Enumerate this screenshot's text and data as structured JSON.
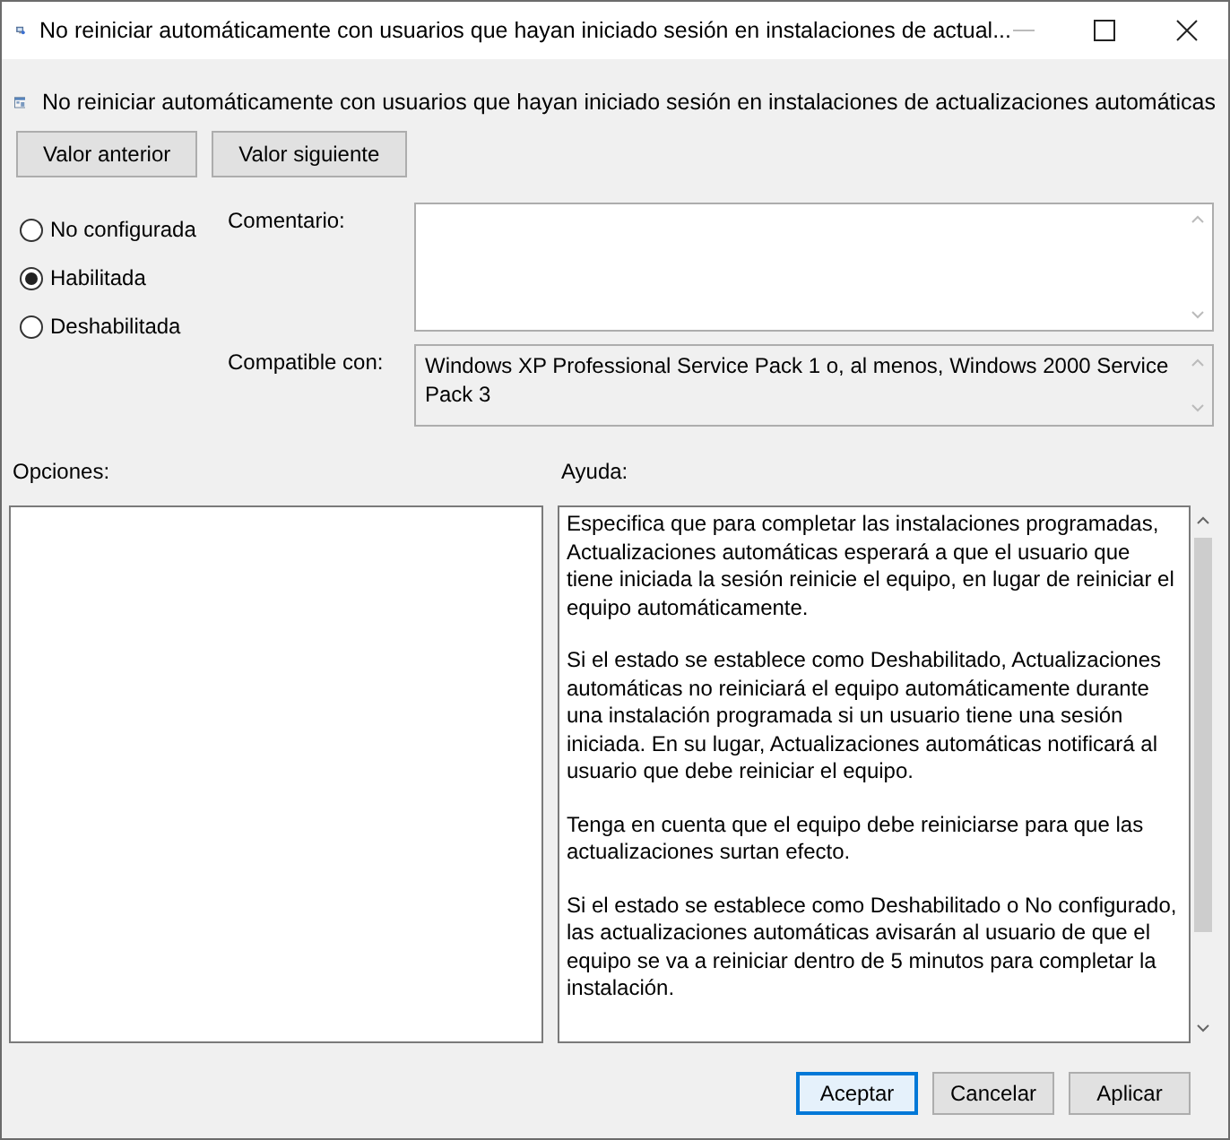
{
  "window": {
    "title": "No reiniciar automáticamente con usuarios que hayan iniciado sesión en instalaciones de actual..."
  },
  "header": {
    "title": "No reiniciar automáticamente con usuarios que hayan iniciado sesión en instalaciones de actualizaciones automáticas"
  },
  "nav_buttons": [
    "Valor anterior",
    "Valor siguiente"
  ],
  "options": [
    {
      "label": "No configurada",
      "selected": false
    },
    {
      "label": "Habilitada",
      "selected": true
    },
    {
      "label": "Deshabilitada",
      "selected": false
    }
  ],
  "comment": {
    "label": "Comentario:"
  },
  "compatible": {
    "label": "Compatible con:",
    "value": "Windows XP Professional Service Pack 1 o, al menos, Windows 2000 Service Pack 3"
  },
  "options_panel": {
    "label": "Opciones:"
  },
  "help_panel": {
    "label": "Ayuda:",
    "paragraphs": [
      "Especifica que para completar las instalaciones programadas, Actualizaciones automáticas esperará a que el usuario que tiene iniciada la sesión reinicie el equipo, en lugar de reiniciar el equipo automáticamente.",
      "Si el estado se establece como Deshabilitado, Actualizaciones automáticas no reiniciará el equipo automáticamente durante una instalación programada si un usuario tiene una sesión iniciada. En su lugar, Actualizaciones automáticas notificará al usuario que debe reiniciar el equipo.",
      "Tenga en cuenta que el equipo debe reiniciarse para que las actualizaciones surtan efecto.",
      "Si el estado se establece como Deshabilitado o No configurado, las actualizaciones automáticas avisarán al usuario de que el equipo se va a reiniciar dentro de 5 minutos para completar la instalación."
    ]
  },
  "footer_buttons": [
    {
      "label": "Aceptar",
      "focused": true
    },
    {
      "label": "Cancelar",
      "focused": false
    },
    {
      "label": "Aplicar",
      "focused": false
    }
  ]
}
